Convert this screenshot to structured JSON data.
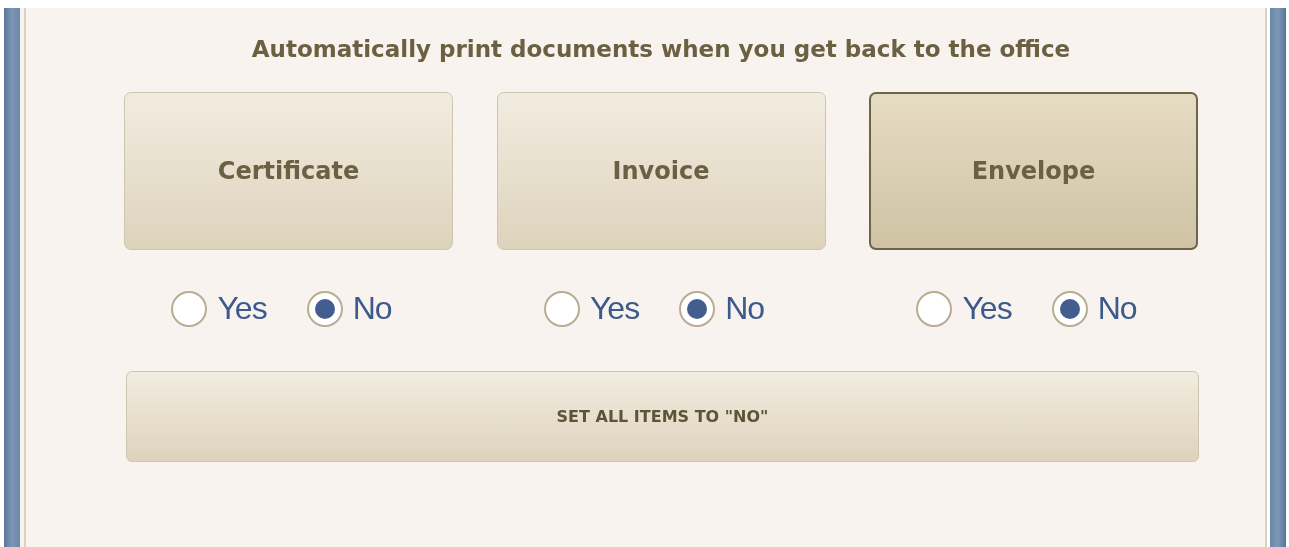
{
  "heading": "Automatically print documents when you get back to the office",
  "documents": [
    {
      "label": "Certificate",
      "hovered": false,
      "options": [
        {
          "label": "Yes",
          "selected": false
        },
        {
          "label": "No",
          "selected": true
        }
      ]
    },
    {
      "label": "Invoice",
      "hovered": false,
      "options": [
        {
          "label": "Yes",
          "selected": false
        },
        {
          "label": "No",
          "selected": true
        }
      ]
    },
    {
      "label": "Envelope",
      "hovered": true,
      "options": [
        {
          "label": "Yes",
          "selected": false
        },
        {
          "label": "No",
          "selected": true
        }
      ]
    }
  ],
  "reset_button": "SET ALL ITEMS TO \"NO\""
}
